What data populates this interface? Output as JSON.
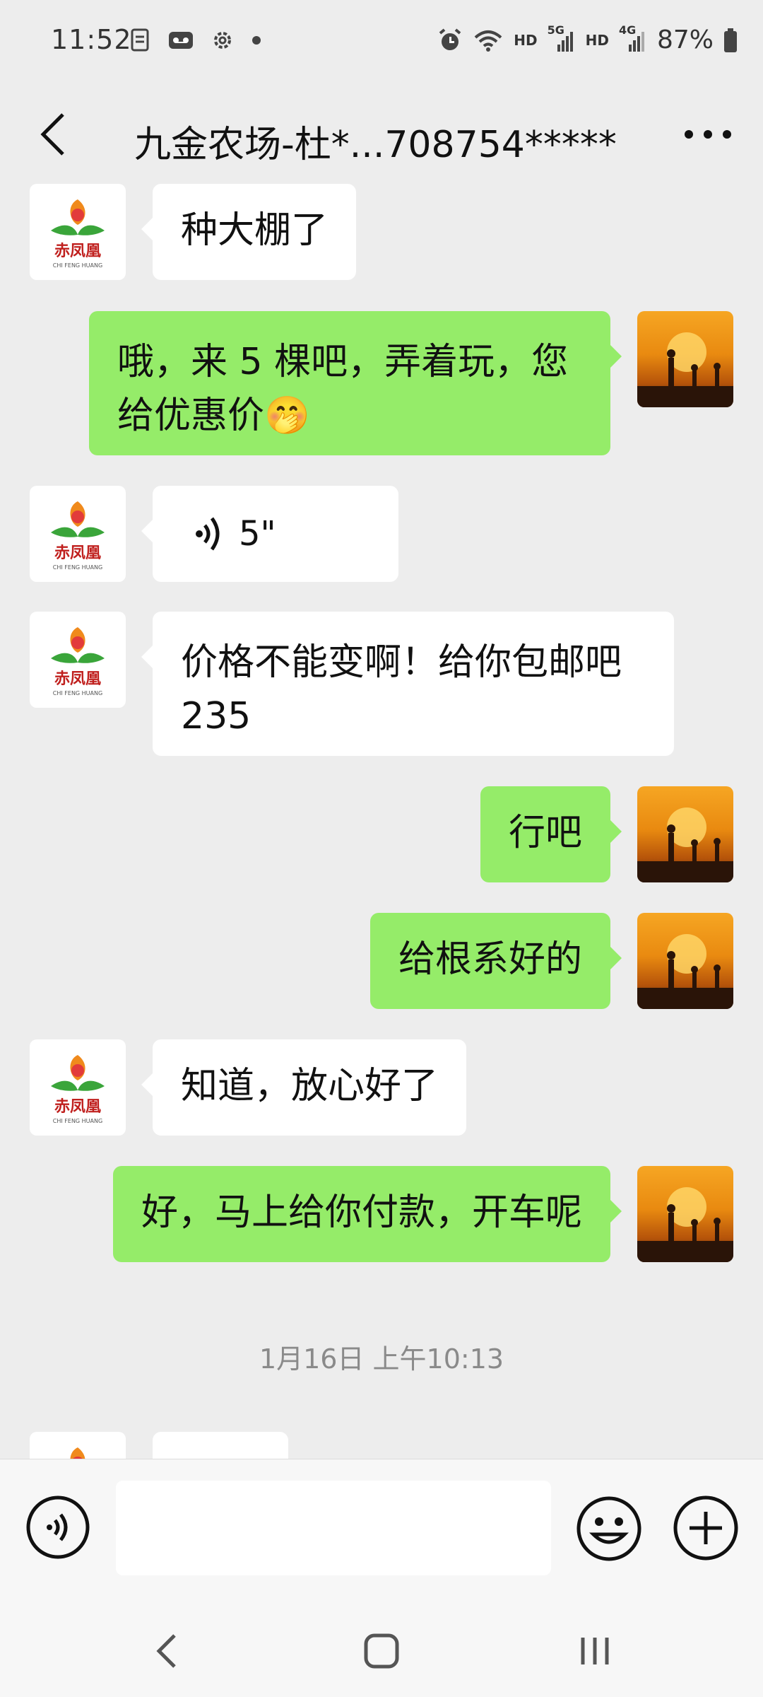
{
  "status_bar": {
    "time": "11:52",
    "battery": "87%",
    "network_labels": [
      "HD",
      "5G",
      "HD",
      "4G"
    ]
  },
  "header": {
    "title": "九金农场-杜*...708754*****"
  },
  "brand_avatar": {
    "logo_text": "赤凤凰",
    "logo_subtext": "CHI FENG HUANG"
  },
  "messages": [
    {
      "side": "left",
      "type": "text",
      "text": "种大棚了"
    },
    {
      "side": "right",
      "type": "text",
      "lines": [
        "哦，来 5 棵吧，弄着玩，您",
        "给优惠价🤭"
      ]
    },
    {
      "side": "left",
      "type": "voice",
      "duration": "5\""
    },
    {
      "side": "left",
      "type": "text",
      "lines": [
        "价格不能变啊！给你包邮吧",
        "235"
      ]
    },
    {
      "side": "right",
      "type": "text",
      "text": "行吧"
    },
    {
      "side": "right",
      "type": "text",
      "text": "给根系好的"
    },
    {
      "side": "left",
      "type": "text",
      "text": "知道，放心好了"
    },
    {
      "side": "right",
      "type": "text",
      "text": "好，马上给你付款，开车呢"
    }
  ],
  "timestamp": "1月16日 上午10:13",
  "input": {
    "value": "",
    "placeholder": ""
  },
  "colors": {
    "background": "#ededed",
    "outgoing_bubble": "#95ec69",
    "incoming_bubble": "#ffffff"
  }
}
